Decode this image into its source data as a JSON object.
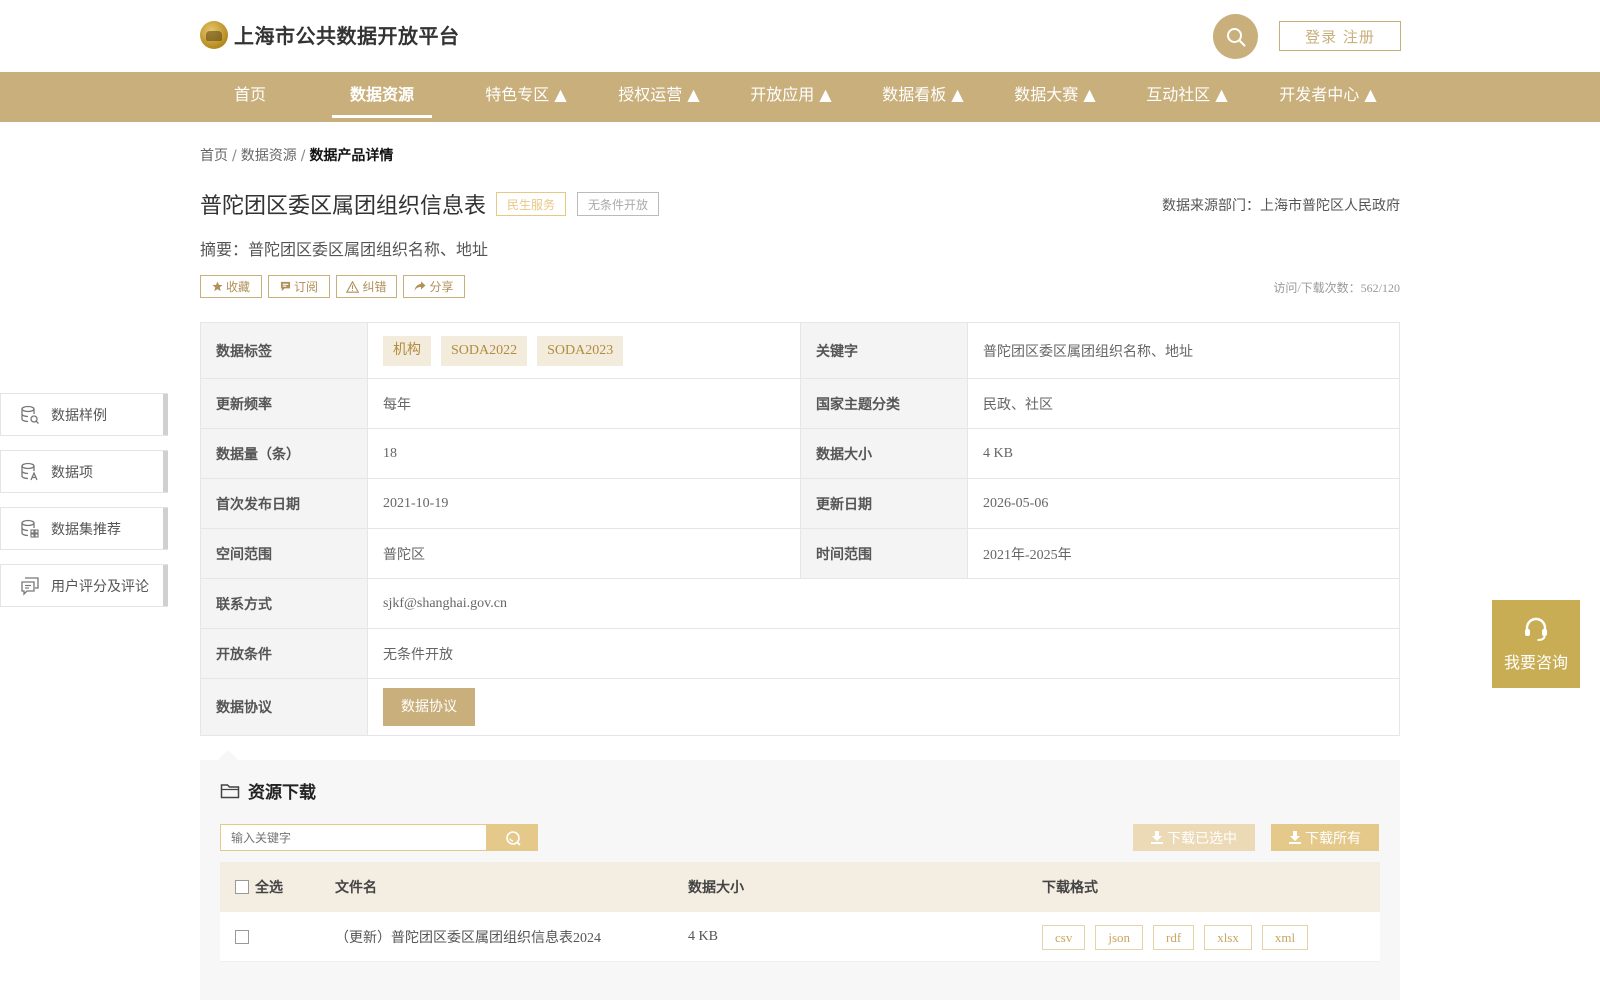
{
  "header": {
    "site_title": "上海市公共数据开放平台",
    "login_label": "登录 注册"
  },
  "nav": [
    {
      "label": "首页"
    },
    {
      "label": "数据资源"
    },
    {
      "label": "特色专区 ▲"
    },
    {
      "label": "授权运营 ▲"
    },
    {
      "label": "开放应用 ▲"
    },
    {
      "label": "数据看板 ▲"
    },
    {
      "label": "数据大赛 ▲"
    },
    {
      "label": "互动社区 ▲"
    },
    {
      "label": "开发者中心 ▲"
    }
  ],
  "breadcrumb": {
    "home": "首页",
    "resources": "数据资源",
    "current": "数据产品详情",
    "sep": "/"
  },
  "dataset": {
    "title": "普陀团区委区属团组织信息表",
    "tag_service": "民生服务",
    "tag_open": "无条件开放",
    "source": "数据来源部门：上海市普陀区人民政府",
    "summary": "摘要：普陀团区委区属团组织名称、地址",
    "visits": "访问/下载次数：562/120"
  },
  "actions": {
    "favorite": "收藏",
    "subscribe": "订阅",
    "correct": "纠错",
    "share": "分享"
  },
  "info": {
    "tags_label": "数据标签",
    "tags": [
      "机构",
      "SODA2022",
      "SODA2023"
    ],
    "keyword_label": "关键字",
    "keyword": "普陀团区委区属团组织名称、地址",
    "freq_label": "更新频率",
    "freq": "每年",
    "theme_label": "国家主题分类",
    "theme": "民政、社区",
    "count_label": "数据量（条）",
    "count": "18",
    "size_label": "数据大小",
    "size": "4 KB",
    "first_label": "首次发布日期",
    "first": "2021-10-19",
    "update_label": "更新日期",
    "update": "2026-05-06",
    "space_label": "空间范围",
    "space": "普陀区",
    "time_label": "时间范围",
    "time": "2021年-2025年",
    "contact_label": "联系方式",
    "contact": "sjkf@shanghai.gov.cn",
    "cond_label": "开放条件",
    "cond": "无条件开放",
    "agree_label": "数据协议",
    "agree_btn": "数据协议"
  },
  "side_menu": [
    {
      "label": "数据样例"
    },
    {
      "label": "数据项"
    },
    {
      "label": "数据集推荐"
    },
    {
      "label": "用户评分及评论"
    }
  ],
  "consult": {
    "label": "我要咨询"
  },
  "resources": {
    "title": "资源下载",
    "search_placeholder": "输入关键字",
    "download_selected": "下载已选中",
    "download_all": "下载所有",
    "col_select_all": "全选",
    "col_filename": "文件名",
    "col_size": "数据大小",
    "col_format": "下载格式",
    "rows": [
      {
        "filename": "（更新）普陀团区委区属团组织信息表2024",
        "size": "4 KB",
        "formats": [
          "csv",
          "json",
          "rdf",
          "xlsx",
          "xml"
        ]
      }
    ]
  },
  "colors": {
    "brand": "#c9af7b",
    "consult": "#c9ad54",
    "tag_bg": "#f3ebdb"
  }
}
